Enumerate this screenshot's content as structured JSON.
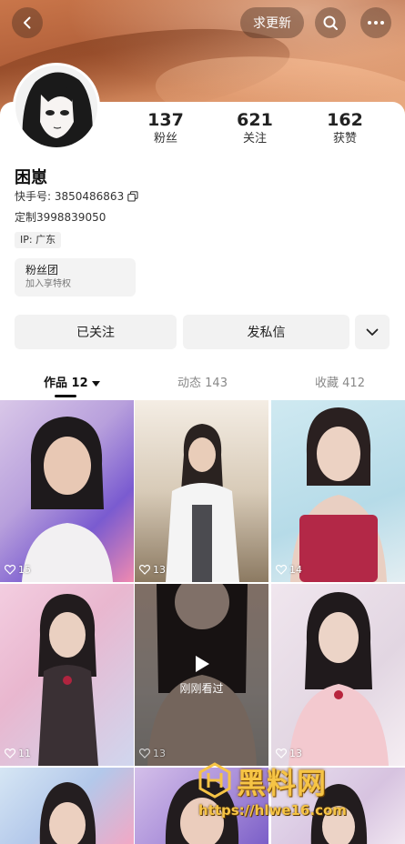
{
  "header": {
    "request_update_label": "求更新"
  },
  "profile": {
    "name": "困崽",
    "kuaishou_id": "快手号: 3850486863",
    "custom": "定制3998839050",
    "ip": "IP: 广东",
    "stats": [
      {
        "value": "137",
        "label": "粉丝"
      },
      {
        "value": "621",
        "label": "关注"
      },
      {
        "value": "162",
        "label": "获赞"
      }
    ]
  },
  "fans_club": {
    "title": "粉丝团",
    "subtitle": "加入享特权"
  },
  "actions": {
    "follow_label": "已关注",
    "message_label": "发私信"
  },
  "tabs": [
    {
      "label": "作品",
      "count": "12"
    },
    {
      "label": "动态",
      "count": "143"
    },
    {
      "label": "收藏",
      "count": "412"
    }
  ],
  "videos": [
    {
      "likes": "15"
    },
    {
      "likes": "13"
    },
    {
      "likes": "14"
    },
    {
      "likes": "11"
    },
    {
      "likes": "13",
      "status": "刚刚看过"
    },
    {
      "likes": "13"
    }
  ],
  "watermark": {
    "title": "黑料网",
    "url": "https://hlwe16.com"
  },
  "colors": {
    "banner": "#c06a42",
    "watermark": "#f6c445"
  },
  "icons": {
    "back": "chevron-left-icon",
    "search": "search-icon",
    "more": "more-icon",
    "copy": "copy-icon",
    "dropdown": "chevron-down-icon",
    "like": "heart-icon",
    "play": "play-icon"
  }
}
